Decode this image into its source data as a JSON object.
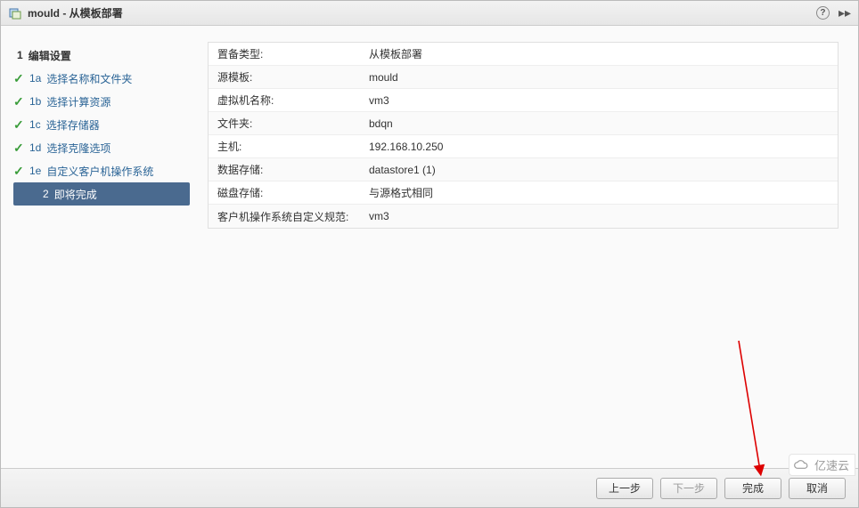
{
  "title": "mould - 从模板部署",
  "sidebar": {
    "heading_num": "1",
    "heading_label": "编辑设置",
    "steps": [
      {
        "num": "1a",
        "label": "选择名称和文件夹",
        "done": true
      },
      {
        "num": "1b",
        "label": "选择计算资源",
        "done": true
      },
      {
        "num": "1c",
        "label": "选择存储器",
        "done": true
      },
      {
        "num": "1d",
        "label": "选择克隆选项",
        "done": true
      },
      {
        "num": "1e",
        "label": "自定义客户机操作系统",
        "done": true
      }
    ],
    "final_num": "2",
    "final_label": "即将完成"
  },
  "summary": [
    {
      "label": "置备类型:",
      "value": "从模板部署"
    },
    {
      "label": "源模板:",
      "value": "mould"
    },
    {
      "label": "虚拟机名称:",
      "value": "vm3"
    },
    {
      "label": "文件夹:",
      "value": "bdqn"
    },
    {
      "label": "主机:",
      "value": "192.168.10.250"
    },
    {
      "label": "数据存储:",
      "value": "datastore1 (1)"
    },
    {
      "label": "磁盘存储:",
      "value": "与源格式相同"
    },
    {
      "label": "客户机操作系统自定义规范:",
      "value": "vm3"
    }
  ],
  "buttons": {
    "back": "上一步",
    "next": "下一步",
    "finish": "完成",
    "cancel": "取消"
  },
  "watermark": "亿速云"
}
